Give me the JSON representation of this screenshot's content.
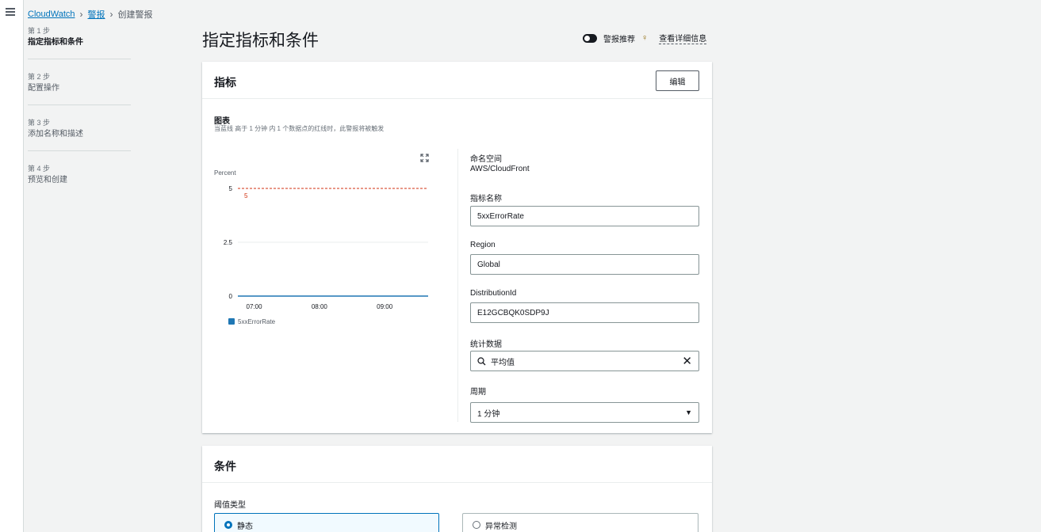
{
  "breadcrumb": {
    "root": "CloudWatch",
    "parent": "警报",
    "current": "创建警报"
  },
  "steps": [
    {
      "num": "第 1 步",
      "label": "指定指标和条件"
    },
    {
      "num": "第 2 步",
      "label": "配置操作"
    },
    {
      "num": "第 3 步",
      "label": "添加名称和描述"
    },
    {
      "num": "第 4 步",
      "label": "预览和创建"
    }
  ],
  "page": {
    "title": "指定指标和条件",
    "recommend_label": "警报推荐",
    "info_link": "查看详细信息"
  },
  "metrics": {
    "title": "指标",
    "edit_label": "编辑",
    "graph_label": "图表",
    "graph_desc": "当蓝线 高于 1 分钟 内 1 个数据点的红线时，此警报将被触发",
    "namespace_label": "命名空间",
    "namespace_value": "AWS/CloudFront",
    "metric_name_label": "指标名称",
    "metric_name_value": "5xxErrorRate",
    "region_label": "Region",
    "region_value": "Global",
    "distribution_label": "DistributionId",
    "distribution_value": "E12GCBQK0SDP9J",
    "statistic_label": "统计数据",
    "statistic_value": "平均值",
    "period_label": "周期",
    "period_value": "1 分钟"
  },
  "conditions": {
    "title": "条件",
    "threshold_type_label": "阈值类型",
    "options": [
      {
        "label": "静态",
        "selected": true
      },
      {
        "label": "异常检测",
        "selected": false
      }
    ]
  },
  "colors": {
    "series": "#1f77b4",
    "threshold": "#d13212",
    "link": "#0073bb"
  },
  "chart_data": {
    "type": "line",
    "ylabel": "Percent",
    "ylim": [
      0,
      5
    ],
    "y_ticks": [
      "0",
      "2.5",
      "5"
    ],
    "x_ticks": [
      "07:00",
      "08:00",
      "09:00"
    ],
    "series": [
      {
        "name": "5xxErrorRate",
        "x": [
          "06:45",
          "09:40"
        ],
        "values": [
          0,
          0
        ]
      }
    ],
    "threshold": {
      "value": 5,
      "label": "5"
    },
    "legend": "bottom-left"
  }
}
